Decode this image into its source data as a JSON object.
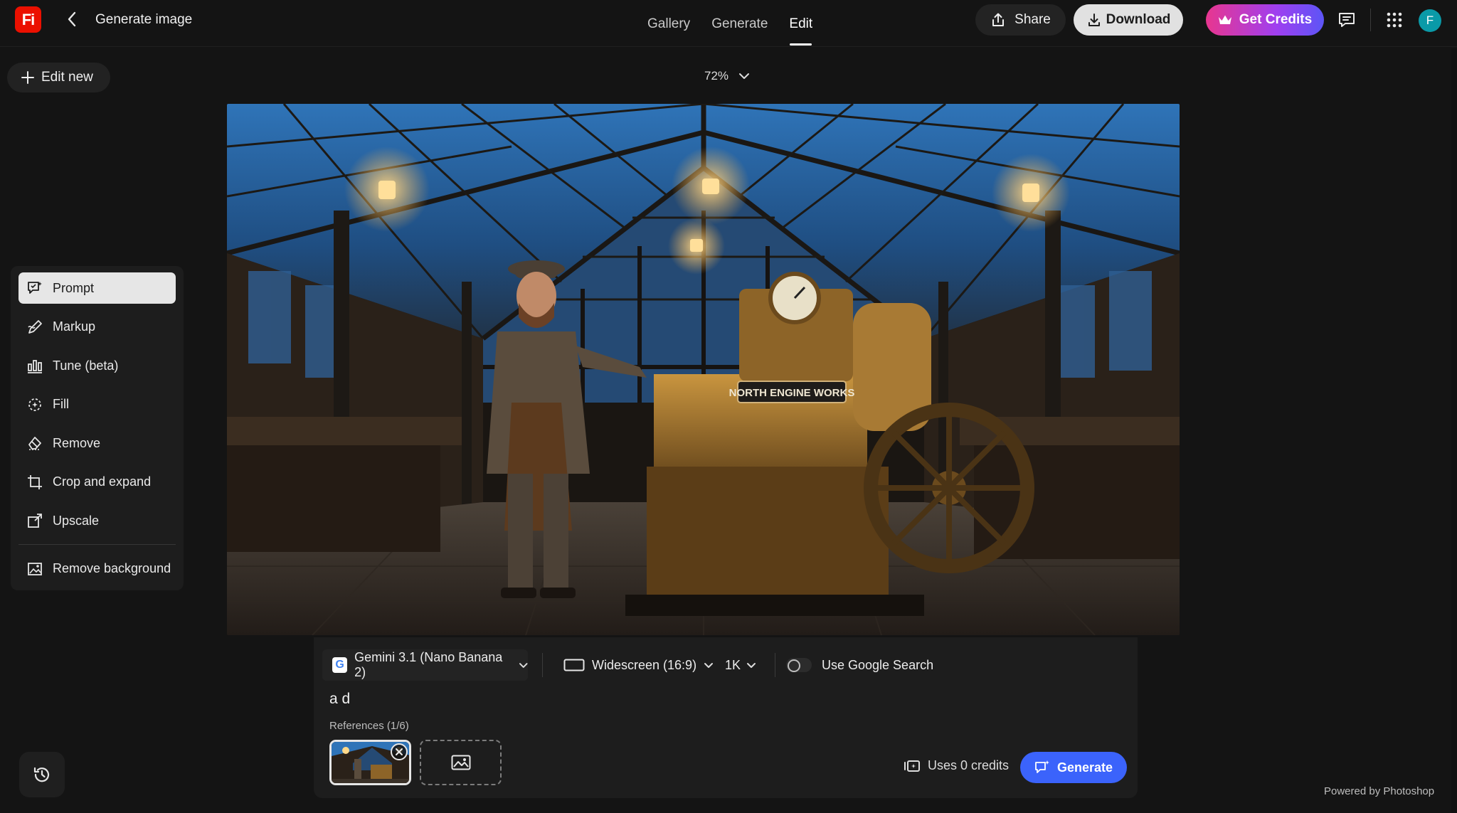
{
  "header": {
    "logo_text": "Fi",
    "title": "Generate image",
    "tabs": [
      {
        "label": "Gallery",
        "active": false
      },
      {
        "label": "Generate",
        "active": false
      },
      {
        "label": "Edit",
        "active": true
      }
    ],
    "share_label": "Share",
    "download_label": "Download",
    "credits_label": "Get Credits",
    "avatar_initial": "F"
  },
  "edit_new_label": "Edit new",
  "zoom_level": "72%",
  "tools": [
    {
      "label": "Prompt",
      "icon": "prompt-icon",
      "active": true
    },
    {
      "label": "Markup",
      "icon": "markup-icon",
      "active": false
    },
    {
      "label": "Tune (beta)",
      "icon": "tune-icon",
      "active": false
    },
    {
      "label": "Fill",
      "icon": "fill-icon",
      "active": false
    },
    {
      "label": "Remove",
      "icon": "remove-icon",
      "active": false
    },
    {
      "label": "Crop and expand",
      "icon": "crop-icon",
      "active": false
    },
    {
      "label": "Upscale",
      "icon": "upscale-icon",
      "active": false
    },
    {
      "label": "Remove background",
      "icon": "remove-background-icon",
      "active": false
    }
  ],
  "canvas": {
    "sign_text": "NORTH ENGINE WORKS"
  },
  "prompt_panel": {
    "model_label": "Gemini 3.1 (Nano Banana 2)",
    "aspect_label": "Widescreen (16:9)",
    "resolution_label": "1K",
    "google_search_label": "Use Google Search",
    "google_search_on": false,
    "prompt_text": "a d",
    "references_label": "References (1/6)",
    "credits_label": "Uses 0 credits",
    "generate_label": "Generate"
  },
  "footer": {
    "powered_by": "Powered by Photoshop"
  },
  "colors": {
    "accent_generate": "#3b63fb",
    "credits_gradient_start": "#e8368f",
    "credits_gradient_end": "#5c55f6",
    "logo_red": "#eb1000",
    "avatar_teal": "#0a9aa8"
  }
}
